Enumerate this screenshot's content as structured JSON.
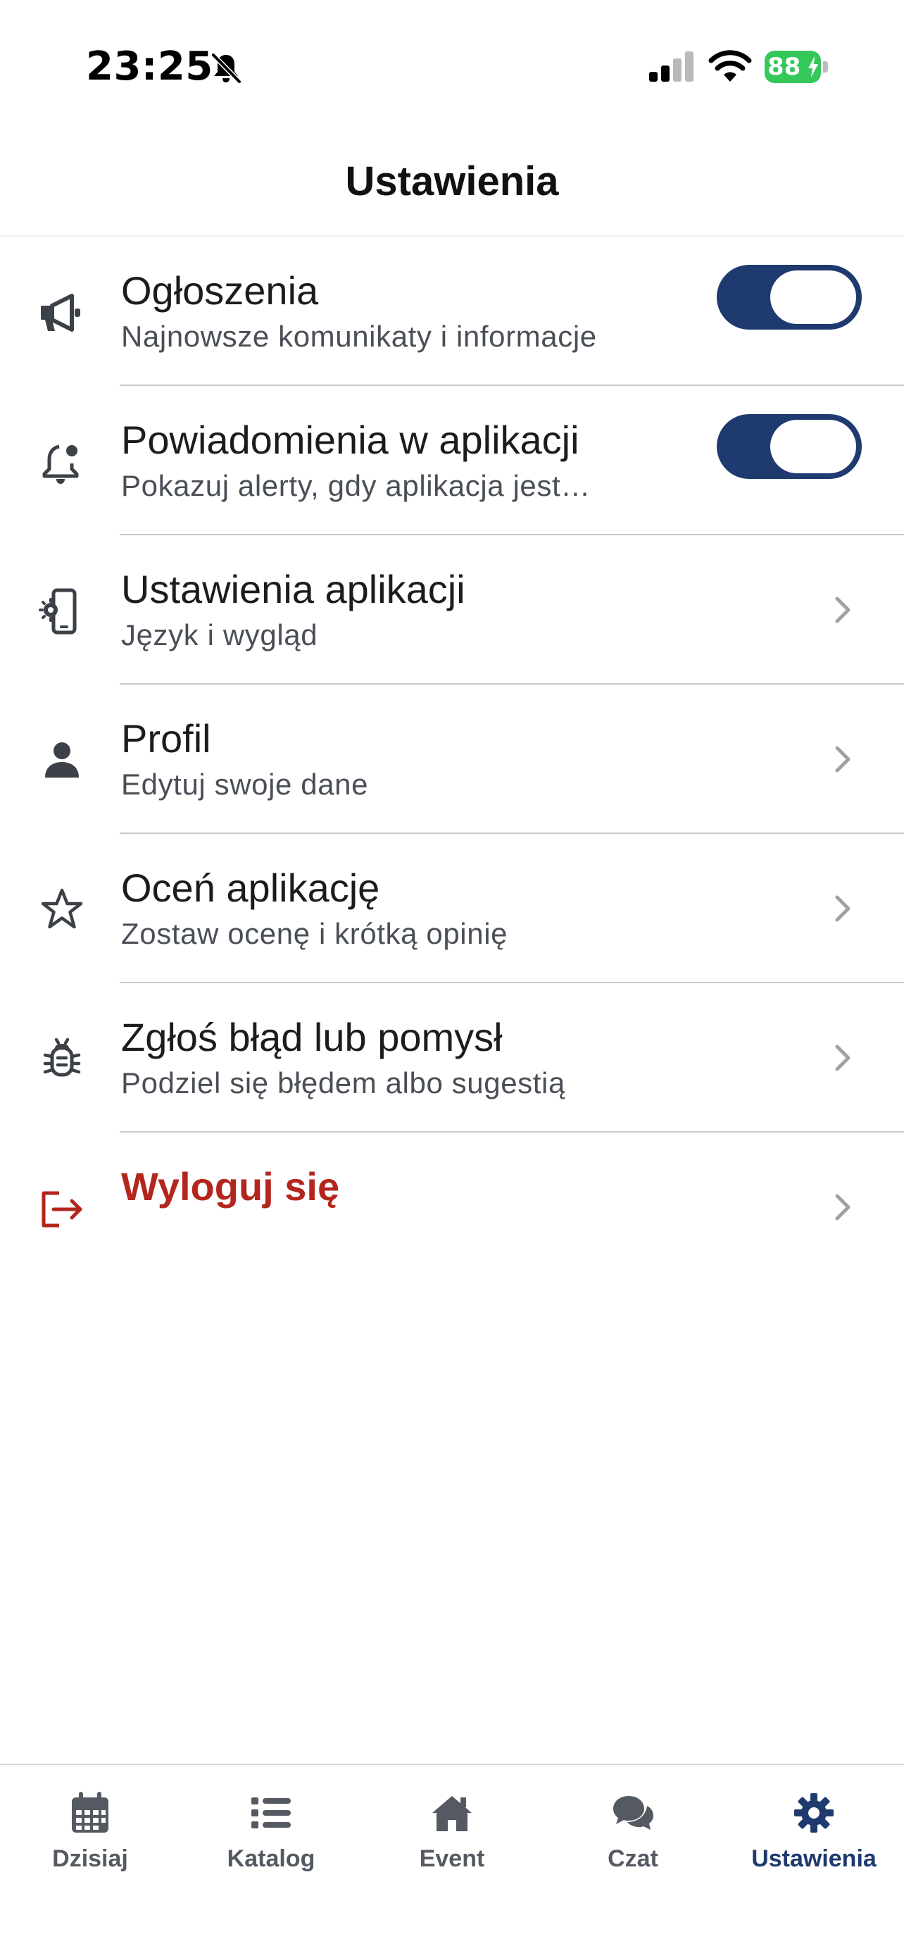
{
  "status_bar": {
    "time": "23:25",
    "battery_percent": "88",
    "icons": [
      "bell-off-icon",
      "signal-icon",
      "wifi-icon",
      "battery-icon"
    ]
  },
  "header": {
    "title": "Ustawienia"
  },
  "settings": {
    "items": [
      {
        "title": "Ogłoszenia",
        "subtitle": "Najnowsze komunikaty i informacje",
        "icon": "megaphone-icon",
        "control": "toggle",
        "toggle_on": true
      },
      {
        "title": "Powiadomienia w aplikacji",
        "subtitle": "Pokazuj alerty, gdy aplikacja jest…",
        "icon": "notification-bell-icon",
        "control": "toggle",
        "toggle_on": true
      },
      {
        "title": "Ustawienia aplikacji",
        "subtitle": "Język i wygląd",
        "icon": "phone-settings-icon",
        "control": "chevron"
      },
      {
        "title": "Profil",
        "subtitle": "Edytuj swoje dane",
        "icon": "person-icon",
        "control": "chevron"
      },
      {
        "title": "Oceń aplikację",
        "subtitle": "Zostaw ocenę i krótką opinię",
        "icon": "star-icon",
        "control": "chevron"
      },
      {
        "title": "Zgłoś błąd lub pomysł",
        "subtitle": "Podziel się błędem albo sugestią",
        "icon": "bug-icon",
        "control": "chevron"
      },
      {
        "title": "Wyloguj się",
        "icon": "logout-icon",
        "control": "chevron"
      }
    ]
  },
  "tab_bar": {
    "tabs": [
      {
        "label": "Dzisiaj",
        "icon": "calendar-icon",
        "active": false
      },
      {
        "label": "Katalog",
        "icon": "list-icon",
        "active": false
      },
      {
        "label": "Event",
        "icon": "home-icon",
        "active": false
      },
      {
        "label": "Czat",
        "icon": "chat-icon",
        "active": false
      },
      {
        "label": "Ustawienia",
        "icon": "gear-icon",
        "active": true
      }
    ]
  },
  "colors": {
    "accent": "#1e3a6e",
    "danger": "#b3261e",
    "battery": "#34c759",
    "secondary_text": "#4a4f57"
  }
}
